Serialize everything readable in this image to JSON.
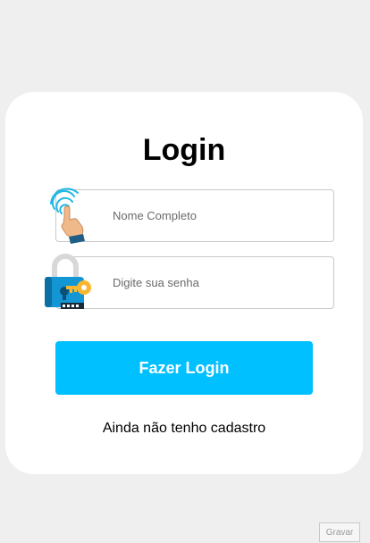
{
  "login_card": {
    "title": "Login",
    "fields": {
      "name": {
        "placeholder": "Nome Completo",
        "value": "",
        "icon": "fingerprint-touch-icon"
      },
      "password": {
        "placeholder": "Digite sua senha",
        "value": "",
        "icon": "padlock-key-icon"
      }
    },
    "submit_label": "Fazer Login",
    "signup_link": "Ainda não tenho cadastro"
  },
  "overlay": {
    "record_label": "Gravar"
  },
  "colors": {
    "accent": "#00c0ff",
    "page_background": "#efefef",
    "card_background": "#ffffff"
  }
}
